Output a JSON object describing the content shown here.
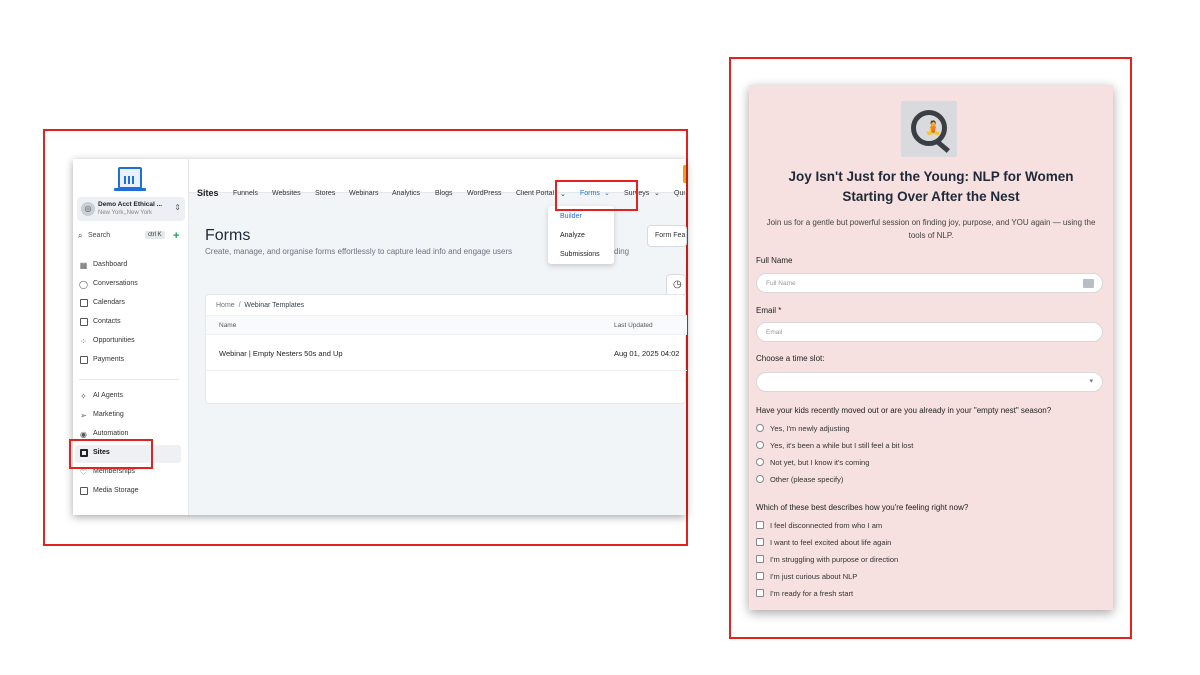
{
  "sidebar": {
    "account_name": "Demo Acct Ethical ...",
    "account_location": "New York,,New York",
    "search_label": "Search",
    "search_shortcut": "ctrl K",
    "items": [
      {
        "label": "Dashboard",
        "icon": "dashboard-icon"
      },
      {
        "label": "Conversations",
        "icon": "chat-icon"
      },
      {
        "label": "Calendars",
        "icon": "calendar-icon"
      },
      {
        "label": "Contacts",
        "icon": "contacts-icon"
      },
      {
        "label": "Opportunities",
        "icon": "opportunities-icon"
      },
      {
        "label": "Payments",
        "icon": "payments-icon"
      },
      {
        "label": "AI Agents",
        "icon": "sparkle-icon"
      },
      {
        "label": "Marketing",
        "icon": "send-icon"
      },
      {
        "label": "Automation",
        "icon": "automation-icon"
      },
      {
        "label": "Sites",
        "icon": "sites-icon"
      },
      {
        "label": "Memberships",
        "icon": "memberships-icon"
      },
      {
        "label": "Media Storage",
        "icon": "media-icon"
      }
    ]
  },
  "topbar": {
    "title": "Sites",
    "tabs": [
      "Funnels",
      "Websites",
      "Stores",
      "Webinars",
      "Analytics",
      "Blogs",
      "WordPress",
      "Client Portal",
      "Forms",
      "Surveys",
      "Qui"
    ],
    "active_tab": "Forms"
  },
  "forms_dropdown": [
    "Builder",
    "Analyze",
    "Submissions"
  ],
  "page": {
    "title": "Forms",
    "subtitle": "Create, manage, and organise forms effortlessly to capture lead info and engage users",
    "subtitle_tail": "ding",
    "feature_button": "Form Fea"
  },
  "table": {
    "breadcrumb_root": "Home",
    "breadcrumb_sep": "/",
    "breadcrumb_current": "Webinar Templates",
    "headers": [
      "Name",
      "Last Updated"
    ],
    "rows": [
      {
        "name": "Webinar | Empty Nesters 50s and Up",
        "updated": "Aug 01, 2025 04:02"
      }
    ]
  },
  "form": {
    "title": "Joy Isn't Just for the Young: NLP for Women Starting Over After the Nest",
    "description": "Join us for a gentle but powerful session on finding joy, purpose, and YOU again — using the tools of NLP.",
    "full_name_label": "Full Name",
    "full_name_placeholder": "Full Name",
    "email_label": "Email *",
    "email_placeholder": "Email",
    "timeslot_label": "Choose a time slot:",
    "q1": "Have your kids recently moved out or are you already in your \"empty nest\" season?",
    "q1_options": [
      "Yes, I'm newly adjusting",
      "Yes, it's been a while but I still feel a bit lost",
      "Not yet, but I know it's coming",
      "Other (please specify)"
    ],
    "q2": "Which of these best describes how you're feeling right now?",
    "q2_options": [
      "I feel disconnected from who I am",
      "I want to feel excited about life again",
      "I'm struggling with purpose or direction",
      "I'm just curious about NLP",
      "I'm ready for a fresh start"
    ]
  },
  "colors": {
    "highlight": "#e3211f",
    "accent": "#1e6fd9",
    "form_background": "#f6e0e0"
  }
}
